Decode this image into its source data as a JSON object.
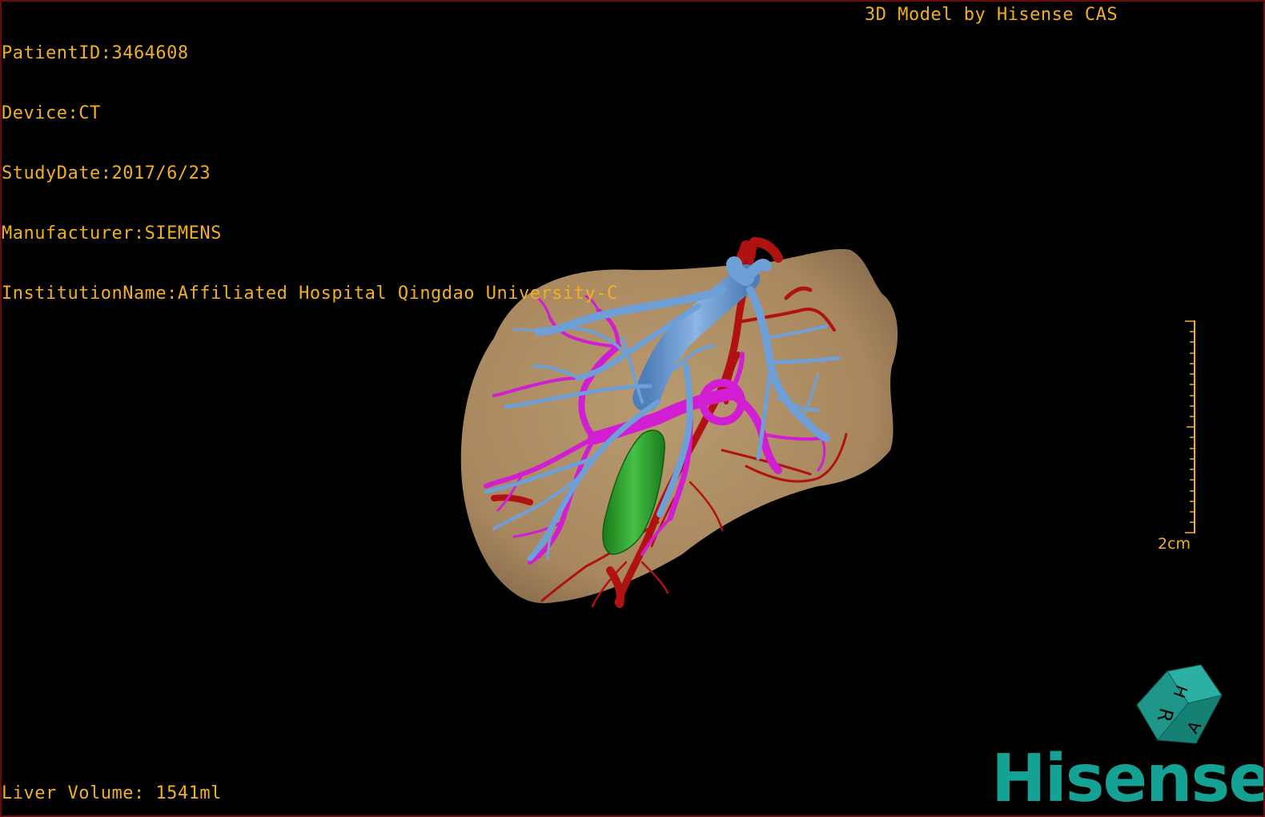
{
  "patient_info": {
    "patient_id": "PatientID:3464608",
    "device": "Device:CT",
    "study_date": "StudyDate:2017/6/23",
    "manufacturer": "Manufacturer:SIEMENS",
    "institution": "InstitutionName:Affiliated Hospital Qingdao University-C"
  },
  "model_credit": "3D Model by Hisense CAS",
  "liver_volume": "Liver Volume: 1541ml",
  "scale": {
    "label": "2cm"
  },
  "orientation_cube": {
    "labels": [
      "H",
      "R",
      "A"
    ]
  },
  "brand": "Hisense",
  "colors": {
    "overlay_text": "#f2b01e",
    "liver": "#a8875f",
    "hepatic_artery": "#b01212",
    "hepatic_vein": "#6e9fd6",
    "portal_vein": "#d21ed2",
    "gallbladder": "#2aa02a",
    "brand": "#14a294",
    "frame_border": "#6b0c0c"
  }
}
